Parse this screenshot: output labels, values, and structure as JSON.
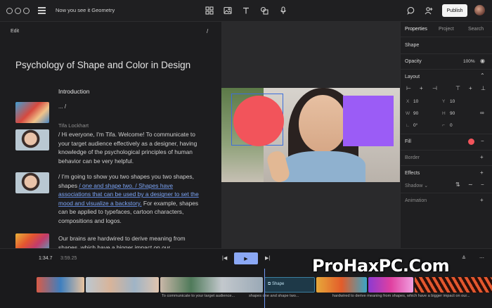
{
  "header": {
    "doc_title": "Now you see it Geometry",
    "publish_label": "Publish",
    "tools": [
      "grid-icon",
      "image-icon",
      "text-icon",
      "shapes-icon",
      "mic-icon"
    ],
    "right_icons": [
      "comment-icon",
      "add-user-icon"
    ]
  },
  "script": {
    "edit_label": "Edit",
    "slash": "/",
    "title": "Psychology of Shape and Color in Design",
    "section": "Introduction",
    "ellipsis": "... /",
    "speaker": "Tifa Lockhart",
    "para1": "/ Hi everyone, I'm Tifa. Welcome! To communicate to your target audience effectively as a designer, having knowledge of the psychological principles of human behavior can be very helpful.",
    "para2_a": "/ I'm going to show you two shapes you two shapes, shapes",
    "para2_hl": "/ one and shape two. / Shapes have associations that can be used by a designer to set the mood and visualize a backstory.",
    "para2_b": "For example, shapes can be applied to typefaces, cartoon characters, compositions and logos.",
    "para3": "Our brains are hardwired to derive meaning from shapes, which have a bigger impact on our"
  },
  "stage": {
    "colors": {
      "circle": "#f2545b",
      "square": "#9b5cf6",
      "selection": "#3c6edb"
    }
  },
  "properties": {
    "tabs": [
      "Properties",
      "Project",
      "Search"
    ],
    "shape_heading": "Shape",
    "opacity_label": "Opacity",
    "opacity_value": "100%",
    "layout_heading": "Layout",
    "x_label": "X",
    "x_value": "10",
    "y_label": "Y",
    "y_value": "10",
    "w_label": "W",
    "w_value": "90",
    "h_label": "H",
    "h_value": "90",
    "rotation_value": "0°",
    "corner_value": "0",
    "fill_label": "Fill",
    "fill_color": "#f2545b",
    "border_label": "Border",
    "effects_label": "Effects",
    "shadow_label": "Shadow",
    "animation_label": "Animation"
  },
  "timeline": {
    "current_time": "1:34.7",
    "total_time": "3:59.25",
    "shape_clip_label": "Shape",
    "captions": [
      "To communicate to your target audience...",
      "shapes one and shape two...",
      "hardwired to derive meaning from shapes, which have a bigger impact on our..."
    ],
    "watermark": "ProHaxPC.Com"
  }
}
